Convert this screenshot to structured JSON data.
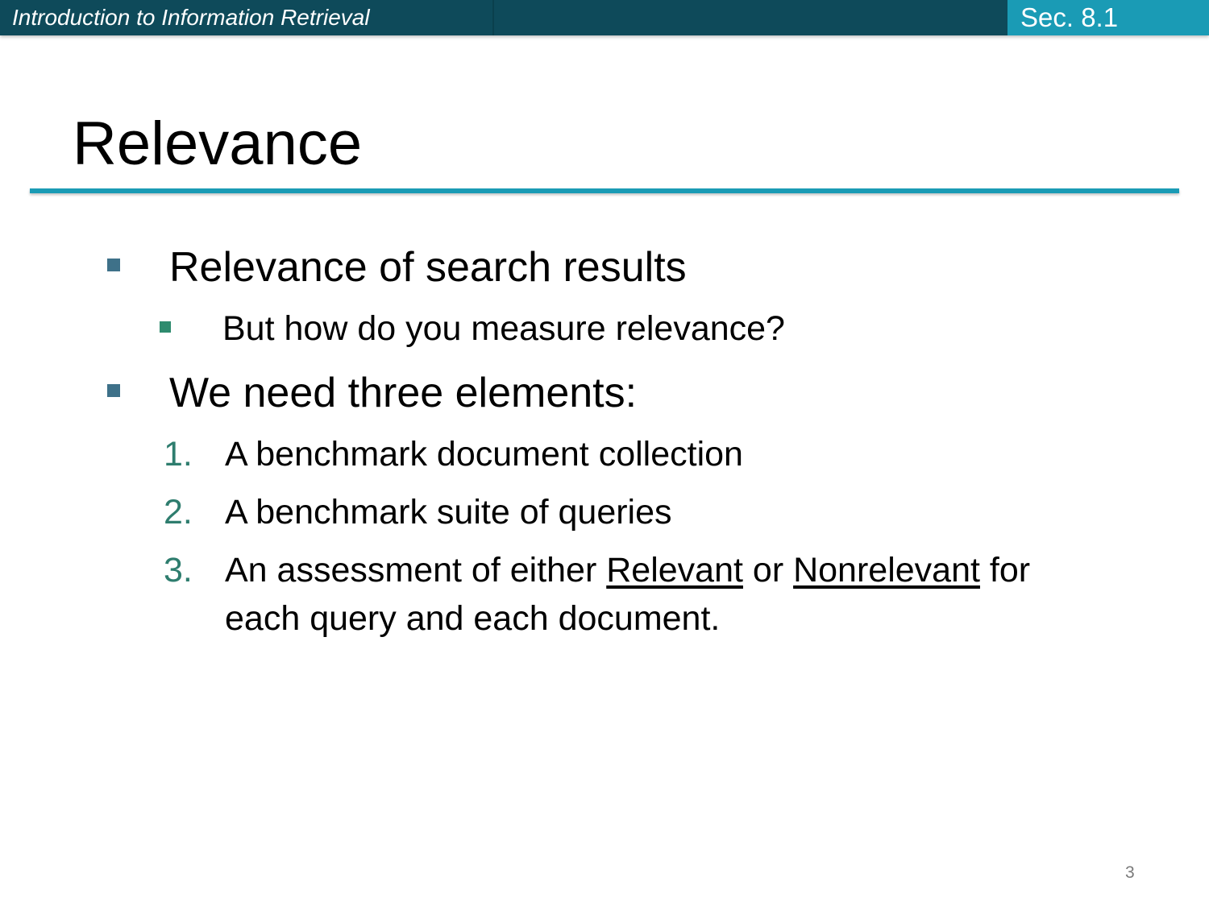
{
  "header": {
    "course_title": "Introduction to Information Retrieval",
    "section": "Sec. 8.1"
  },
  "slide": {
    "title": "Relevance",
    "bullets": [
      {
        "text": "Relevance of search results",
        "sub": [
          "But how do you measure relevance?"
        ]
      },
      {
        "text": "We need three elements:",
        "numbered": [
          {
            "num": "1.",
            "text": "A benchmark document collection"
          },
          {
            "num": "2.",
            "text": "A benchmark suite of queries"
          },
          {
            "num": "3.",
            "line1_pre": "An assessment of either ",
            "line1_rel": "Relevant",
            "line1_mid": " or ",
            "line1_nonrel": "Nonrelevant",
            "line1_post": " for",
            "line2": "each query and each document."
          }
        ]
      }
    ]
  },
  "page_number": "3",
  "colors": {
    "header_dark": "#0e4a5a",
    "header_accent": "#1a9bb5",
    "bullet_level1": "#3e7189",
    "bullet_level2": "#2e8b6e",
    "number_color": "#2e7d6e"
  }
}
